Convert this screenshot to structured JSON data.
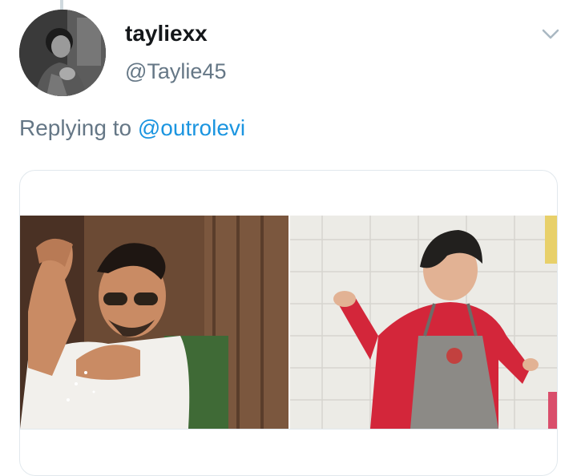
{
  "tweet": {
    "author": {
      "display_name": "tayliexx",
      "handle": "@Taylie45"
    },
    "reply_context": {
      "prefix": "Replying to ",
      "mention": "@outrolevi"
    },
    "menu_icon": "chevron-down-icon",
    "media": [
      {
        "name": "photo-left-salt-gesture",
        "palette": {
          "bg": "#6b4a34",
          "shirt": "#f2f0ec",
          "skin": "#c98b64"
        }
      },
      {
        "name": "photo-right-apron-gesture",
        "palette": {
          "bg": "#ecebe6",
          "shirt": "#d3263a",
          "apron": "#8c8a86"
        }
      }
    ]
  },
  "colors": {
    "handle_gray": "#657786",
    "link_blue": "#1b95e0",
    "border": "#e1e8ed"
  }
}
